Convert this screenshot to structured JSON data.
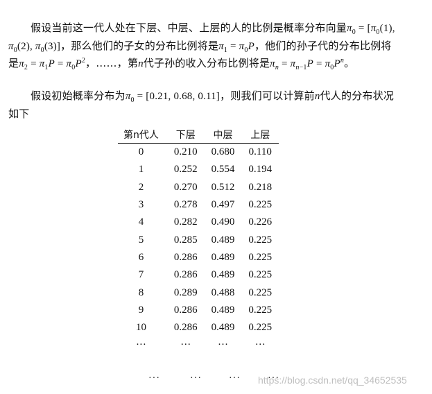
{
  "paragraph1": {
    "t1": "假设当前这一代人处在下层、中层、上层的人的比例是概率分布向量",
    "t2": "，那么他们的子女的分布比例将是",
    "t3": "，他们的孙子代的分布比例将是",
    "t4": "，……，第",
    "t5": "代子孙的收入分布比例将是",
    "t6": "。"
  },
  "paragraph2": {
    "t1": "假设初始概率分布为",
    "t2": "，则我们可以计算前",
    "t3": "代人的分布状况如下"
  },
  "table": {
    "headers": [
      "第n代人",
      "下层",
      "中层",
      "上层"
    ],
    "rows": [
      [
        "0",
        "0.210",
        "0.680",
        "0.110"
      ],
      [
        "1",
        "0.252",
        "0.554",
        "0.194"
      ],
      [
        "2",
        "0.270",
        "0.512",
        "0.218"
      ],
      [
        "3",
        "0.278",
        "0.497",
        "0.225"
      ],
      [
        "4",
        "0.282",
        "0.490",
        "0.226"
      ],
      [
        "5",
        "0.285",
        "0.489",
        "0.225"
      ],
      [
        "6",
        "0.286",
        "0.489",
        "0.225"
      ],
      [
        "7",
        "0.286",
        "0.489",
        "0.225"
      ],
      [
        "8",
        "0.289",
        "0.488",
        "0.225"
      ],
      [
        "9",
        "0.286",
        "0.489",
        "0.225"
      ],
      [
        "10",
        "0.286",
        "0.489",
        "0.225"
      ]
    ],
    "ellipsis_row": [
      "···",
      "···",
      "···",
      "···"
    ],
    "trailing_dots": [
      "···",
      "···",
      "···",
      "···"
    ]
  },
  "watermark": "https://blog.csdn.net/qq_34652535"
}
